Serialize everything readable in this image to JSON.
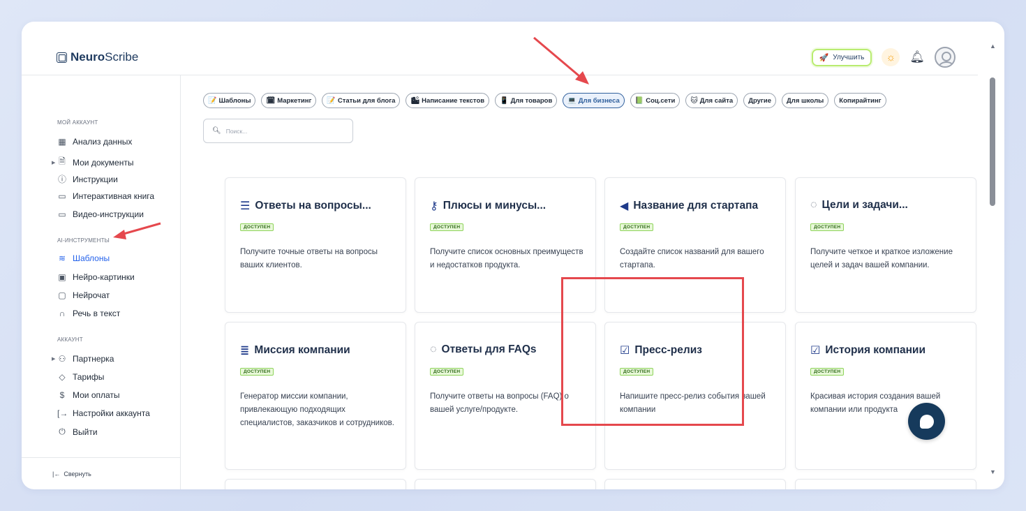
{
  "brand": {
    "name_bold": "Neuro",
    "name_rest": "Scribe"
  },
  "header": {
    "upgrade_label": "Улучшить"
  },
  "sidebar": {
    "sections": [
      {
        "title": "МОЙ АККАУНТ"
      },
      {
        "title": "AI-ИНСТРУМЕНТЫ"
      },
      {
        "title": "АККАУНТ"
      }
    ],
    "items": [
      {
        "label": "Анализ данных"
      },
      {
        "label": "Мои документы"
      },
      {
        "label": "Инструкции"
      },
      {
        "label": "Интерактивная книга"
      },
      {
        "label": "Видео-инструкции"
      },
      {
        "label": "Шаблоны"
      },
      {
        "label": "Нейро-картинки"
      },
      {
        "label": "Нейрочат"
      },
      {
        "label": "Речь в текст"
      },
      {
        "label": "Партнерка"
      },
      {
        "label": "Тарифы"
      },
      {
        "label": "Мои оплаты"
      },
      {
        "label": "Настройки аккаунта"
      },
      {
        "label": "Выйти"
      }
    ],
    "collapse_label": "Свернуть"
  },
  "main": {
    "top_faded_text": "",
    "chips": [
      {
        "label": "Шаблоны",
        "icon": "📝"
      },
      {
        "label": "Маркетинг",
        "icon": "🗓"
      },
      {
        "label": "Статьи для блога",
        "icon": "📝"
      },
      {
        "label": "Написание текстов",
        "icon": "🏙"
      },
      {
        "label": "Для товаров",
        "icon": "📱"
      },
      {
        "label": "Для бизнеса",
        "icon": "💻"
      },
      {
        "label": "Соц.сети",
        "icon": "📗"
      },
      {
        "label": "Для сайта",
        "icon": "🐱"
      },
      {
        "label": "Другие",
        "icon": ""
      },
      {
        "label": "Для школы",
        "icon": ""
      },
      {
        "label": "Копирайтинг",
        "icon": ""
      }
    ],
    "active_chip": "Для бизнеса",
    "search": {
      "placeholder": "Поиск..."
    },
    "cards": [
      {
        "title": "Ответы на вопросы...",
        "badge": "ДОСТУПЕН",
        "desc": "Получите точные ответы на вопросы ваших клиентов.",
        "icon": "list-icon"
      },
      {
        "title": "Плюсы и минусы...",
        "badge": "ДОСТУПЕН",
        "desc": "Получите список основных преимуществ и недостатков продукта.",
        "icon": "key-icon"
      },
      {
        "title": "Название для стартапа",
        "badge": "ДОСТУПЕН",
        "desc": "Создайте список названий для вашего стартапа.",
        "icon": "megaphone-icon"
      },
      {
        "title": "Цели и задачи...",
        "badge": "ДОСТУПЕН",
        "desc": "Получите четкое и краткое изложение целей и задач вашей компании.",
        "icon": "clock-icon"
      },
      {
        "title": "Миссия компании",
        "badge": "ДОСТУПЕН",
        "desc": "Генератор миссии компании, привлекающую подходящих специалистов, заказчиков и сотрудников.",
        "icon": "align-icon"
      },
      {
        "title": "Ответы для FAQs",
        "badge": "ДОСТУПЕН",
        "desc": "Получите ответы на вопросы (FAQ) о вашей услуге/продукте.",
        "icon": "clock-icon"
      },
      {
        "title": "Пресс-релиз",
        "badge": "ДОСТУПЕН",
        "desc": "Напишите пресс-релиз события вашей компании",
        "icon": "checkbox-icon"
      },
      {
        "title": "История компании",
        "badge": "ДОСТУПЕН",
        "desc": "Красивая история создания вашей компании или продукта",
        "icon": "checkbox-icon"
      }
    ]
  },
  "colors": {
    "accent": "#2563eb",
    "badge_green": "#8ed35a",
    "highlight_red": "#e5484d",
    "chat_bubble": "#163a5c"
  }
}
